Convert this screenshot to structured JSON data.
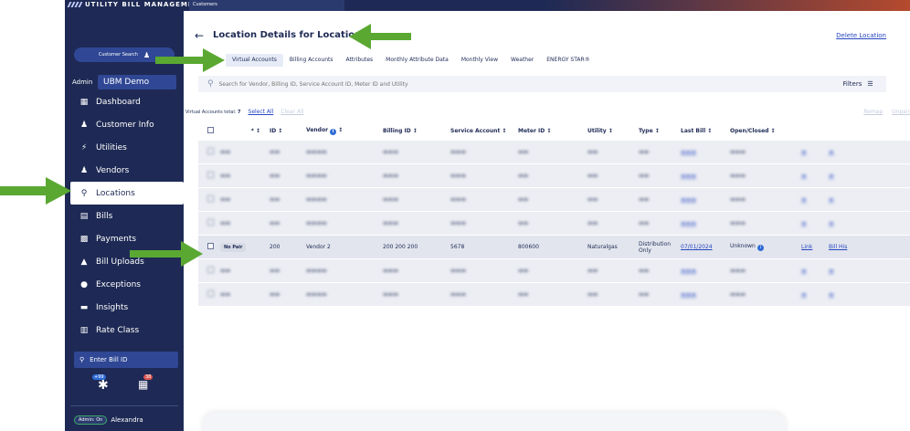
{
  "app": {
    "brand": "UTILITY BILL MANAGEMENT",
    "breadcrumb": "Customers"
  },
  "sidebar": {
    "customer_search": "Customer Search",
    "admin_label": "Admin",
    "tenant": "UBM Demo",
    "items": [
      {
        "label": "Dashboard",
        "icon": "dashboard-icon"
      },
      {
        "label": "Customer Info",
        "icon": "person-icon"
      },
      {
        "label": "Utilities",
        "icon": "bolt-icon"
      },
      {
        "label": "Vendors",
        "icon": "person-icon"
      },
      {
        "label": "Locations",
        "icon": "location-pin-icon"
      },
      {
        "label": "Bills",
        "icon": "bill-icon"
      },
      {
        "label": "Payments",
        "icon": "payment-icon"
      },
      {
        "label": "Bill Uploads",
        "icon": "upload-icon"
      },
      {
        "label": "Exceptions",
        "icon": "alert-icon"
      },
      {
        "label": "Insights",
        "icon": "insights-icon"
      },
      {
        "label": "Rate Class",
        "icon": "rate-icon"
      }
    ],
    "bill_search": "Enter Bill ID",
    "badge_left": "+99",
    "badge_right": "38",
    "admin_toggle": "Admin: On",
    "user": "Alexandra"
  },
  "main": {
    "title": "Location Details for Location 2",
    "delete": "Delete Location",
    "tabs": [
      "Virtual Accounts",
      "Billing Accounts",
      "Attributes",
      "Monthly Attribute Data",
      "Monthly View",
      "Weather",
      "ENERGY STAR®"
    ],
    "search_placeholder": "Search for Vendor, Billing ID, Service Account ID, Meter ID and Utility",
    "filters": "Filters",
    "totals_label": "Virtual Accounts total:",
    "totals_value": "7",
    "select_all": "Select All",
    "clear_all": "Clear All",
    "remap": "Remap",
    "unpair": "Unpair",
    "columns": {
      "star": "*",
      "id": "ID",
      "vendor": "Vendor",
      "billing": "Billing ID",
      "service": "Service Account",
      "meter": "Meter ID",
      "utility": "Utility",
      "type": "Type",
      "last_bill": "Last Bill",
      "open_closed": "Open/Closed"
    },
    "focus_row": {
      "pair": "No Pair",
      "id": "200",
      "vendor": "Vendor 2",
      "billing": "200 200 200",
      "service": "5678",
      "meter": "800600",
      "utility": "Naturalgas",
      "type": "Distribution Only",
      "last_bill": "07/01/2024",
      "status": "Unknown",
      "link": "Link",
      "history": "Bill His"
    }
  }
}
